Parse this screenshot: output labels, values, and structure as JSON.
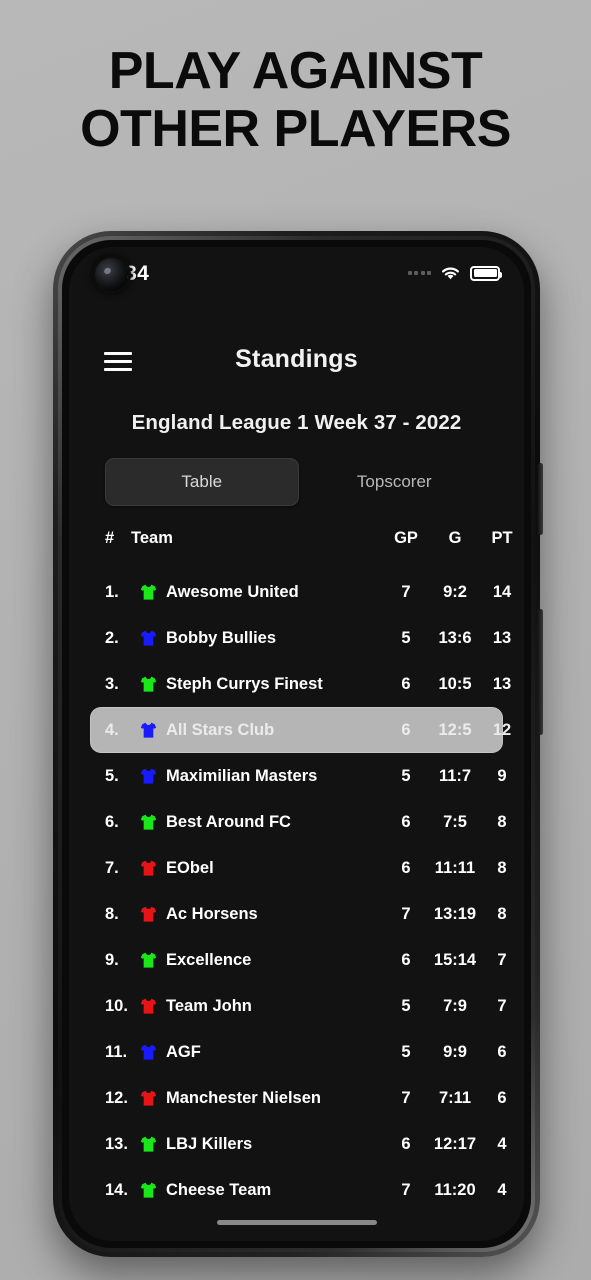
{
  "promo": {
    "line1": "PLAY AGAINST",
    "line2": "OTHER PLAYERS"
  },
  "status_bar": {
    "time": "9.34",
    "signal_icon": "signal-dots-icon",
    "wifi_icon": "wifi-icon",
    "battery_icon": "battery-full-icon",
    "camera": "front-camera-punchhole"
  },
  "app": {
    "menu_icon": "hamburger-menu-icon",
    "title": "Standings",
    "subtitle": "England League 1 Week 37 - 2022"
  },
  "tabs": [
    {
      "label": "Table",
      "active": true
    },
    {
      "label": "Topscorer",
      "active": false
    }
  ],
  "table": {
    "headers": {
      "rank": "#",
      "team": "Team",
      "gp": "GP",
      "g": "G",
      "pt": "PT"
    },
    "rows": [
      {
        "rank": "1.",
        "jersey": "green",
        "team": "Awesome United",
        "gp": "7",
        "g": "9:2",
        "pt": "14",
        "highlight": false
      },
      {
        "rank": "2.",
        "jersey": "blue",
        "team": "Bobby Bullies",
        "gp": "5",
        "g": "13:6",
        "pt": "13",
        "highlight": false
      },
      {
        "rank": "3.",
        "jersey": "green",
        "team": "Steph Currys Finest",
        "gp": "6",
        "g": "10:5",
        "pt": "13",
        "highlight": false
      },
      {
        "rank": "4.",
        "jersey": "blue",
        "team": "All Stars Club",
        "gp": "6",
        "g": "12:5",
        "pt": "12",
        "highlight": true
      },
      {
        "rank": "5.",
        "jersey": "blue",
        "team": "Maximilian Masters",
        "gp": "5",
        "g": "11:7",
        "pt": "9",
        "highlight": false
      },
      {
        "rank": "6.",
        "jersey": "green",
        "team": "Best Around FC",
        "gp": "6",
        "g": "7:5",
        "pt": "8",
        "highlight": false
      },
      {
        "rank": "7.",
        "jersey": "red",
        "team": "EObel",
        "gp": "6",
        "g": "11:11",
        "pt": "8",
        "highlight": false
      },
      {
        "rank": "8.",
        "jersey": "red",
        "team": "Ac Horsens",
        "gp": "7",
        "g": "13:19",
        "pt": "8",
        "highlight": false
      },
      {
        "rank": "9.",
        "jersey": "green",
        "team": "Excellence",
        "gp": "6",
        "g": "15:14",
        "pt": "7",
        "highlight": false
      },
      {
        "rank": "10.",
        "jersey": "red",
        "team": "Team John",
        "gp": "5",
        "g": "7:9",
        "pt": "7",
        "highlight": false
      },
      {
        "rank": "11.",
        "jersey": "blue",
        "team": "AGF",
        "gp": "5",
        "g": "9:9",
        "pt": "6",
        "highlight": false
      },
      {
        "rank": "12.",
        "jersey": "red",
        "team": "Manchester Nielsen",
        "gp": "7",
        "g": "7:11",
        "pt": "6",
        "highlight": false
      },
      {
        "rank": "13.",
        "jersey": "green",
        "team": "LBJ Killers",
        "gp": "6",
        "g": "12:17",
        "pt": "4",
        "highlight": false
      },
      {
        "rank": "14.",
        "jersey": "green",
        "team": "Cheese Team",
        "gp": "7",
        "g": "11:20",
        "pt": "4",
        "highlight": false
      }
    ]
  },
  "colors": {
    "page_background": "#b4b4b4",
    "screen_background": "#121212",
    "highlight_row": "#b5b5b5",
    "tab_active": "#2b2b2b",
    "jersey_green": "#1ae61a",
    "jersey_blue": "#1a1aff",
    "jersey_red": "#e61414"
  },
  "home_indicator": "home-indicator-bar"
}
